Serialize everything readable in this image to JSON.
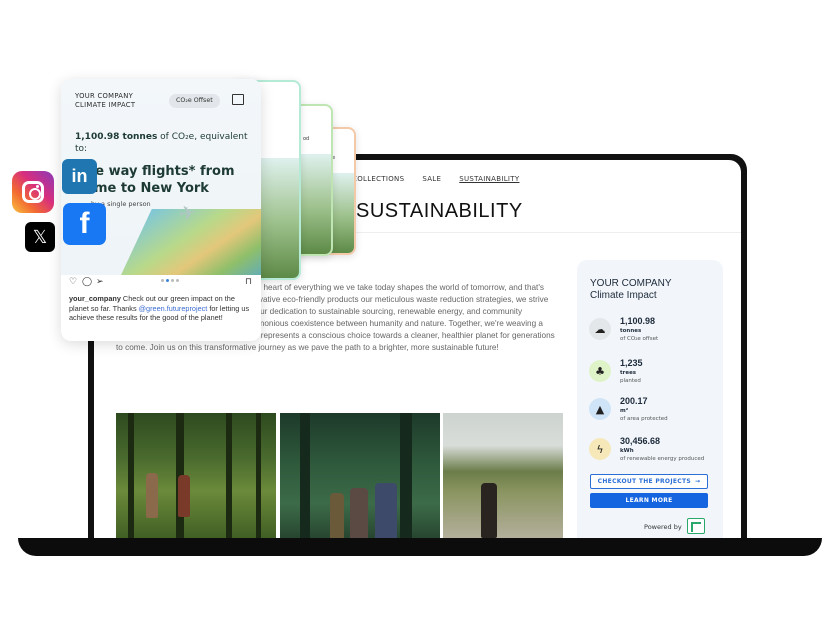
{
  "website": {
    "nav": [
      "COLLECTIONS",
      "SALE",
      "SUSTAINABILITY"
    ],
    "heading": "SUSTAINABILITY",
    "paragraph": "commitment to a greener future is at the heart of everything we ve take today shapes the world of tomorrow, and that's why t a way of life for us. From our innovative eco-friendly products our meticulous waste reduction strategies, we strive to set the esponsibility in the industry. Our dedication to sustainable sourcing, renewable energy, and community engagement reflects our vision of a harmonious coexistence between humanity and nature. Together, we're weaving a tapestry of progress where each thread represents a conscious choice towards a cleaner, healthier planet for generations to come. Join us on this transformative journey as we pave the path to a brighter, more sustainable future!"
  },
  "widget": {
    "title": [
      "YOUR COMPANY",
      "Climate Impact"
    ],
    "stats": [
      {
        "value": "1,100.98",
        "unit": "tonnes",
        "desc": "of CO₂e offset",
        "icon": "cloud-icon",
        "color": "#e4e7ea"
      },
      {
        "value": "1,235",
        "unit": "trees",
        "desc": "planted",
        "icon": "tree-icon",
        "color": "#dff3c9"
      },
      {
        "value": "200.17",
        "unit": "m²",
        "desc": "of area protected",
        "icon": "landscape-icon",
        "color": "#cfe4f7"
      },
      {
        "value": "30,456.68",
        "unit": "kWh",
        "desc": "of renewable energy produced",
        "icon": "lightning-icon",
        "color": "#f6e8b8"
      }
    ],
    "checkout_label": "CHECKOUT THE PROJECTS",
    "learn_more_label": "LEARN MORE",
    "powered_label": "Powered by",
    "accent": "#1565e0"
  },
  "post": {
    "company": [
      "YOUR COMPANY",
      "CLIMATE IMPACT"
    ],
    "pill": "CO₂e Offset",
    "stat_value": "1,100.98 tonnes",
    "stat_rest": " of CO₂e, equivalent to:",
    "headline": "One way flights* from Rome to New York",
    "sub": "by a single person",
    "username": "your_company",
    "caption_a": " Check out our green impact on the planet so far. Thanks ",
    "handle": "@green.futureproject",
    "caption_b": " for letting us achieve these results for the good of the planet!"
  },
  "back_cards": {
    "card2_text": "od",
    "card3_text": "e"
  },
  "social": {
    "linkedin": "in",
    "facebook": "f",
    "x": "𝕏"
  }
}
